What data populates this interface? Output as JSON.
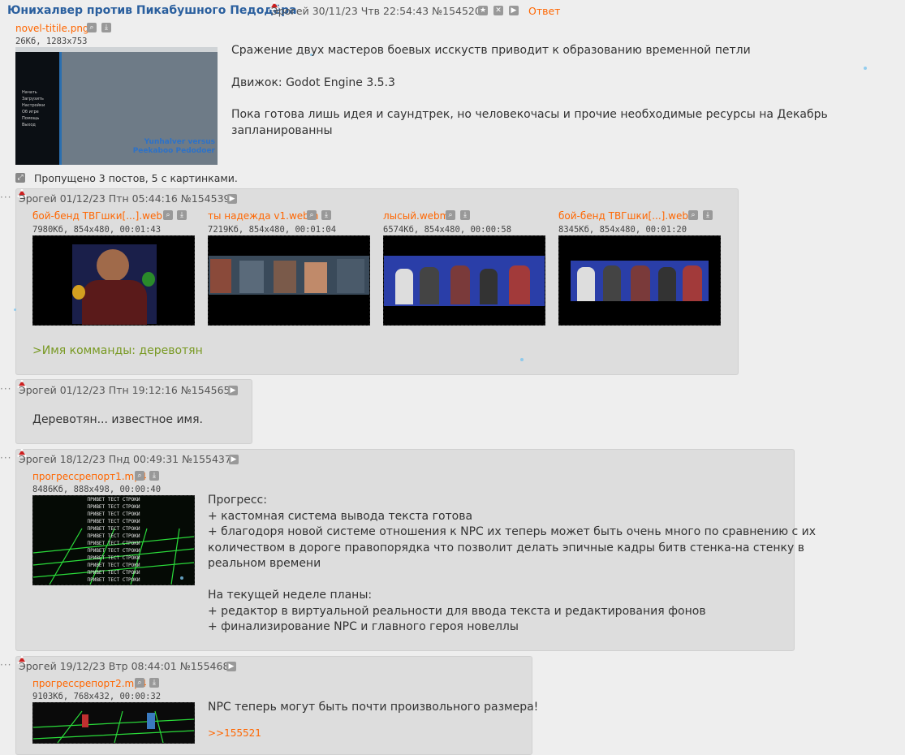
{
  "op": {
    "subject": "Юнихалвер против Пикабушного Педодёра",
    "author": "Эрогей",
    "date": "30/11/23 Чтв 22:54:43",
    "num": "№154520",
    "reply_label": "Ответ",
    "file": {
      "name": "novel-titile.png",
      "meta": "26Кб, 1283x753"
    },
    "thumb_menu": [
      "Начать",
      "Загрузить",
      "Настройки",
      "Об игре",
      "Помощь",
      "Выход"
    ],
    "thumb_caption": "Yunhalver versus Peekaboo Pedodoer",
    "lines": [
      "Сражение двух мастеров боевых исскуств приводит к образованию временной петли",
      "Движок: Godot Engine 3.5.3",
      "Пока готова лишь идея и саундтрек, но человекочасы и прочие необходимые ресурсы на Декабрь запланированны"
    ]
  },
  "skipped": "Пропущено 3 постов, 5 с картинками.",
  "posts": [
    {
      "author": "Эрогей",
      "date": "01/12/23 Птн 05:44:16",
      "num": "№154539",
      "files": [
        {
          "name": "бой-бенд ТВГшки[...].webm",
          "meta": "7980Кб, 854x480, 00:01:43"
        },
        {
          "name": "ты надежда v1.webm",
          "meta": "7219Кб, 854x480, 00:01:04"
        },
        {
          "name": "лысый.webm",
          "meta": "6574Кб, 854x480, 00:00:58"
        },
        {
          "name": "бой-бенд ТВГшки[...].webm",
          "meta": "8345Кб, 854x480, 00:01:20"
        }
      ],
      "greentext": ">Имя комманды: деревотян"
    },
    {
      "author": "Эрогей",
      "date": "01/12/23 Птн 19:12:16",
      "num": "№154565",
      "text": "Деревотян... известное имя."
    },
    {
      "author": "Эрогей",
      "date": "18/12/23 Пнд 00:49:31",
      "num": "№155437",
      "file": {
        "name": "прогрессрепорт1.mp4",
        "meta": "8486Кб, 888x498, 00:00:40"
      },
      "thumb_text": "ПРИВЕТ ТЕСТ СТРОКИ",
      "lines": [
        "Прогресс:",
        "+ кастомная система вывода текста готова",
        "+ благодоря новой системе отношения к NPC их теперь может быть очень много по сравнению с их",
        "количеством в дороге правопорядка что позволит делать эпичные кадры битв стенка-на стенку в",
        "реальном времени",
        "",
        "На текущей неделе планы:",
        "+ редактор в виртуальной реальности для ввода текста и редактирования фонов",
        "+ финализирование NPC и главного героя новеллы"
      ]
    },
    {
      "author": "Эрогей",
      "date": "19/12/23 Втр 08:44:01",
      "num": "№155468",
      "file": {
        "name": "прогрессрепорт2.mp4",
        "meta": "9103Кб, 768x432, 00:00:32"
      },
      "text": "NPC теперь могут быть почти произвольного размера!",
      "reply_link": ">>155521"
    }
  ]
}
